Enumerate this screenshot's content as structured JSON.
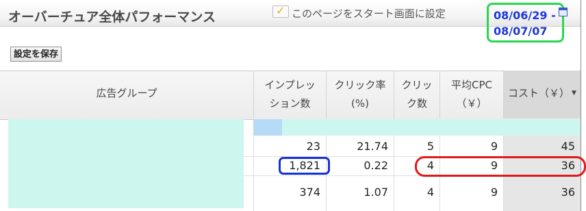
{
  "header": {
    "title": "オーバーチュア全体パフォーマンス",
    "startup_label": "このページをスタート画面に設定",
    "date_from": "08/06/29",
    "date_sep": "-",
    "date_to": "08/07/07",
    "calendar_icon": "calendar-icon"
  },
  "toolbar": {
    "save_label": "設定を保存"
  },
  "table": {
    "columns": [
      {
        "label": "広告グループ"
      },
      {
        "label_line1": "インプレッ",
        "label_line2": "ション数"
      },
      {
        "label_line1": "クリック率",
        "label_line2": "(%)"
      },
      {
        "label_line1": "クリッ",
        "label_line2": "ク数"
      },
      {
        "label_line1": "平均CPC",
        "label_line2": "（￥）"
      },
      {
        "label": "コスト（￥）"
      }
    ],
    "sort_icon": "sort-down-icon",
    "rows": [
      {
        "impressions": "23",
        "ctr": "21.74",
        "clicks": "5",
        "avg_cpc": "9",
        "cost": "45"
      },
      {
        "impressions": "1,821",
        "ctr": "0.22",
        "clicks": "4",
        "avg_cpc": "9",
        "cost": "36"
      },
      {
        "impressions": "374",
        "ctr": "1.07",
        "clicks": "4",
        "avg_cpc": "9",
        "cost": "36"
      }
    ]
  },
  "colors": {
    "date_text": "#1c37d6",
    "date_box": "#27d84f",
    "highlight_blue": "#1430d8",
    "highlight_red": "#e11818",
    "masked_area": "#cdf6ee"
  }
}
